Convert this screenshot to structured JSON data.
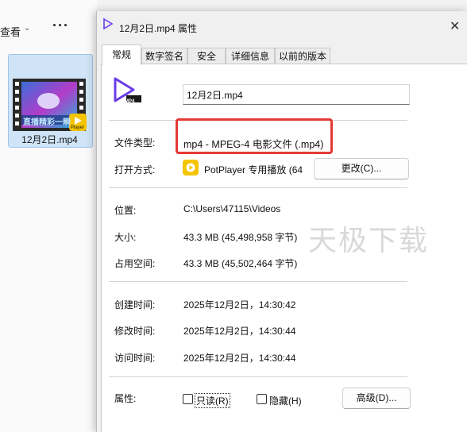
{
  "explorer": {
    "view_label": "查看",
    "view_chevron": "⌄",
    "more_label": "···",
    "file_name": "12月2日.mp4",
    "thumbnail_caption": "直播精彩一瞬",
    "player_badge": "Player"
  },
  "dialog": {
    "title": "12月2日.mp4 属性",
    "close": "✕",
    "tabs": [
      {
        "label": "常规",
        "active": true
      },
      {
        "label": "数字签名"
      },
      {
        "label": "安全"
      },
      {
        "label": "详细信息"
      },
      {
        "label": "以前的版本"
      }
    ],
    "file_icon_badge": "MP4",
    "file_name_value": "12月2日.mp4",
    "file_type_label": "文件类型:",
    "file_type_value": "mp4 - MPEG-4 电影文件 (.mp4)",
    "opens_with_label": "打开方式:",
    "opens_with_value": "PotPlayer 专用播放 (64",
    "change_button": "更改(C)...",
    "location_label": "位置:",
    "location_value": "C:\\Users\\47115\\Videos",
    "size_label": "大小:",
    "size_value": "43.3 MB (45,498,958 字节)",
    "size_on_disk_label": "占用空间:",
    "size_on_disk_value": "43.3 MB (45,502,464 字节)",
    "created_label": "创建时间:",
    "created_value": "2025年12月2日，14:30:42",
    "modified_label": "修改时间:",
    "modified_value": "2025年12月2日，14:30:44",
    "accessed_label": "访问时间:",
    "accessed_value": "2025年12月2日，14:30:44",
    "attributes_label": "属性:",
    "readonly_label": "只读(R)",
    "hidden_label": "隐藏(H)",
    "advanced_button": "高级(D)..."
  },
  "watermark": "天极下载",
  "colors": {
    "highlight": "#e53935",
    "potplayer": "#f5c400",
    "media_icon": "#6a3de8"
  }
}
